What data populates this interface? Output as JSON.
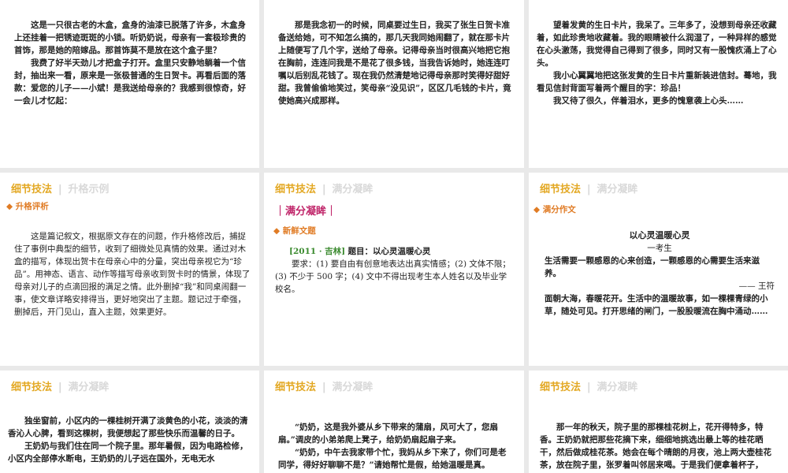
{
  "slides": {
    "s1": {
      "p1": "这是一只很古老的木盒，盒身的油漆已脱落了许多，木盒身上还挂着一把锈迹斑斑的小锁。听奶奶说，母亲有一套极珍贵的首饰，那是她的陪嫁品。那首饰莫不是放在这个盒子里？",
      "p2": "我费了好半天劲儿才把盒子打开。盒里只安静地躺着一个信封，抽出来一看，原来是一张极普通的生日贺卡。再看后面的落款：爱您的儿子——小斌！是我送给母亲的？我感到很惊奇，好一会儿才忆起："
    },
    "s2": {
      "p1": "那是我念初一的时候，同桌要过生日，我买了张生日贺卡准备送给她，可不知怎么搞的，那几天我同她闹翻了，就在那卡片上随便写了几个字，送给了母亲。记得母亲当时很高兴地把它抱在胸前，连连问我是不是花了很多钱，当我告诉她时，她连连叮嘱以后别乱花钱了。现在我仍然清楚地记得母亲那时笑得好甜好甜。我曾偷偷地笑过，笑母亲“没见识”，区区几毛钱的卡片，竟使她高兴成那样。"
    },
    "s3": {
      "p1": "望着发黄的生日卡片，我呆了。三年多了，没想到母亲还收藏着，如此珍贵地收藏着。我的眼睛被什么润湿了，一种异样的感觉在心头激荡，我觉得自己得到了很多，同时又有一股愧疚涌上了心头。",
      "p2": "我小心翼翼地把这张发黄的生日卡片重新装进信封。蓦地，我看见信封背面写着两个醒目的字：珍品！",
      "p3": "我又待了很久，伴着泪水，更多的愧意袭上心头……"
    },
    "s4": {
      "h_a": "细节技法",
      "h_b": "升格示例",
      "label": "◆ 升格评析",
      "p1": "这是篇记叙文，根据原文存在的问题，作升格修改后，捕捉住了事例中典型的细节，收到了细微处见真情的效果。通过对木盒的描写，体现出贺卡在母亲心中的分量，突出母亲视它为“珍品”。用神态、语言、动作等描写母亲收到贺卡时的情景，体现了母亲对儿子的点滴回报的满足之情。此外删掉“我”和同桌闹翻一事，使文章详略安排得当，更好地突出了主题。题记过于牵强，删掉后，开门见山，直入主题，效果更好。"
    },
    "s5": {
      "h_a": "细节技法",
      "h_b": "满分凝眸",
      "title": "｜满分凝眸｜",
      "label": "◆ 新鲜文题",
      "tag": "[2011 · 吉林]",
      "qtitle": "题目：以心灵温暖心灵",
      "req": "要求：(1) 要自由有创意地表达出真实情感；(2) 文体不限；(3) 不少于 500 字；(4) 文中不得出现考生本人姓名以及毕业学校名。"
    },
    "s6": {
      "h_a": "细节技法",
      "h_b": "满分凝眸",
      "label": "◆ 满分作文",
      "etitle": "以心灵温暖心灵",
      "author": "一考生",
      "motto": "生活需要一颗感恩的心来创造，一颗感恩的心需要生活来滋养。",
      "motto_src": "—— 王符",
      "p1": "面朝大海，春暖花开。生活中的温暖故事，如一棵棵青绿的小草，随处可见。打开思绪的闸门，一股股暖流在胸中涌动……"
    },
    "s7": {
      "h_a": "细节技法",
      "h_b": "满分凝眸",
      "p1": "独坐窗前，小区内的一棵桂树开满了淡黄色的小花，淡淡的清香沁人心脾，看到这棵树，我便想起了那些快乐而温馨的日子。",
      "p2": "王奶奶与我们住在同一个院子里。那年暑假，因为电路检修，小区内全部停水断电，王奶奶的儿子远在国外，无电无水"
    },
    "s8": {
      "h_a": "细节技法",
      "h_b": "满分凝眸",
      "p1": "“奶奶，这是我外婆从乡下带来的蒲扇，风可大了，您扇扇。”调皮的小弟弟爬上凳子，给奶奶扇起扇子来。",
      "p2": "“奶奶，中午去我家带个忙，我妈从乡下来了，你们可是老同学，得好好聊聊不是？”请她帮忙是假，给她温暖是真。"
    },
    "s9": {
      "h_a": "细节技法",
      "h_b": "满分凝眸",
      "p1": "那一年的秋天，院子里的那棵桂花树上，花开得特多，特香。王奶奶就把那些花摘下来，细细地挑选出最上等的桂花晒干，然后做成桂花茶。她会在每个晴朗的月夜，池上两大壶桂花茶，放在院子里，张罗着叫邻居来喝。于是我们便拿着杯子，"
    }
  }
}
